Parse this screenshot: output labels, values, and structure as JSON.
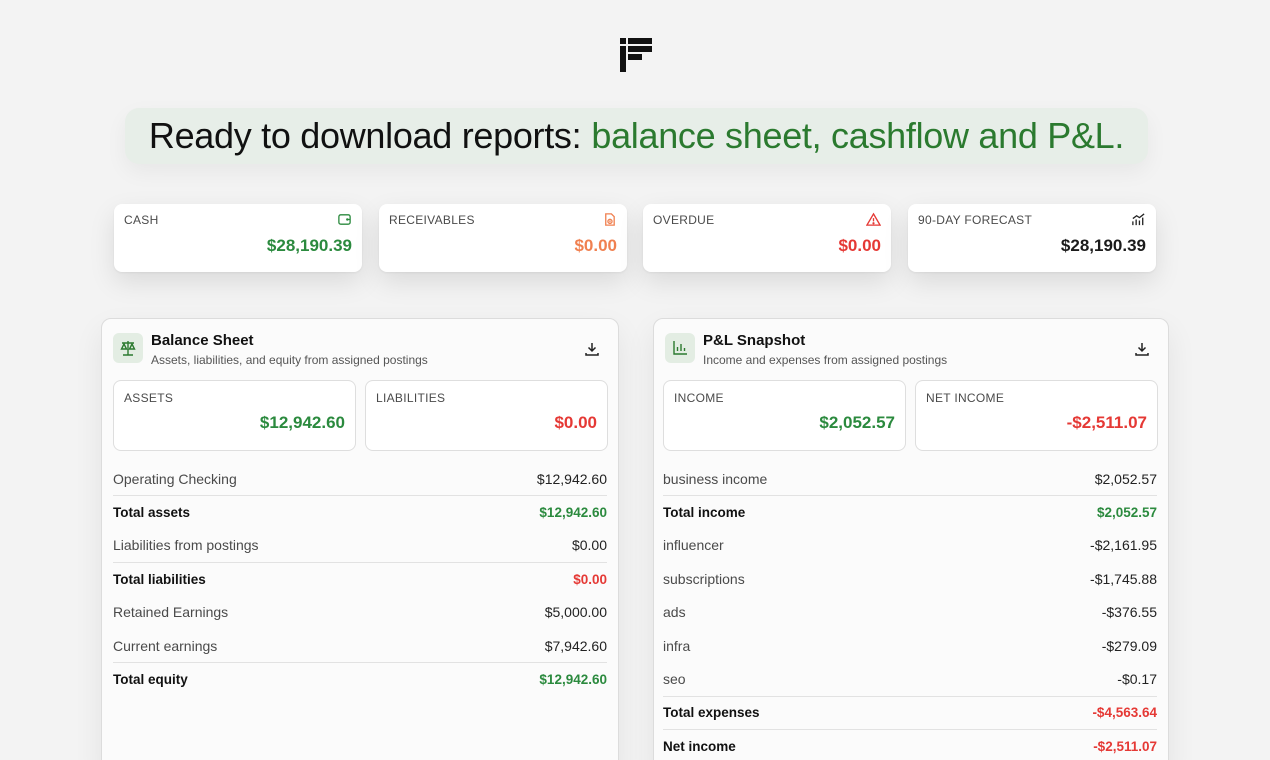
{
  "headline": {
    "dark": "Ready to download reports:",
    "green": "balance sheet, cashflow and P&L."
  },
  "colors": {
    "positive": "#2b8a3e",
    "negative": "#e53935",
    "receivable": "#f08050",
    "brand_green": "#2b7a2f"
  },
  "kpis": [
    {
      "label": "CASH",
      "value": "$28,190.39",
      "icon": "wallet-icon",
      "tone": "pos"
    },
    {
      "label": "RECEIVABLES",
      "value": "$0.00",
      "icon": "receivables-icon",
      "tone": "orange"
    },
    {
      "label": "OVERDUE",
      "value": "$0.00",
      "icon": "alert-triangle-icon",
      "tone": "neg"
    },
    {
      "label": "90-DAY FORECAST",
      "value": "$28,190.39",
      "icon": "trend-chart-icon",
      "tone": "plain"
    }
  ],
  "balance_sheet": {
    "title": "Balance Sheet",
    "subtitle": "Assets, liabilities, and equity from assigned postings",
    "icon": "scale-icon",
    "assets_label": "ASSETS",
    "assets_value": "$12,942.60",
    "liabilities_label": "LIABILITIES",
    "liabilities_value": "$0.00",
    "rows": [
      {
        "label": "Operating Checking",
        "value": "$12,942.60",
        "total": false,
        "tone": ""
      },
      {
        "label": "Total assets",
        "value": "$12,942.60",
        "total": true,
        "tone": "pos"
      },
      {
        "label": "Liabilities from postings",
        "value": "$0.00",
        "total": false,
        "tone": ""
      },
      {
        "label": "Total liabilities",
        "value": "$0.00",
        "total": true,
        "tone": "neg"
      },
      {
        "label": "Retained Earnings",
        "value": "$5,000.00",
        "total": false,
        "tone": ""
      },
      {
        "label": "Current earnings",
        "value": "$7,942.60",
        "total": false,
        "tone": ""
      },
      {
        "label": "Total equity",
        "value": "$12,942.60",
        "total": true,
        "tone": "pos"
      }
    ]
  },
  "pnl": {
    "title": "P&L Snapshot",
    "subtitle": "Income and expenses from assigned postings",
    "icon": "bar-chart-icon",
    "income_label": "INCOME",
    "income_value": "$2,052.57",
    "net_label": "NET INCOME",
    "net_value": "-$2,511.07",
    "rows": [
      {
        "label": "business income",
        "value": "$2,052.57",
        "total": false,
        "tone": ""
      },
      {
        "label": "Total income",
        "value": "$2,052.57",
        "total": true,
        "tone": "pos"
      },
      {
        "label": "influencer",
        "value": "-$2,161.95",
        "total": false,
        "tone": ""
      },
      {
        "label": "subscriptions",
        "value": "-$1,745.88",
        "total": false,
        "tone": ""
      },
      {
        "label": "ads",
        "value": "-$376.55",
        "total": false,
        "tone": ""
      },
      {
        "label": "infra",
        "value": "-$279.09",
        "total": false,
        "tone": ""
      },
      {
        "label": "seo",
        "value": "-$0.17",
        "total": false,
        "tone": ""
      },
      {
        "label": "Total expenses",
        "value": "-$4,563.64",
        "total": true,
        "tone": "neg"
      },
      {
        "label": "Net income",
        "value": "-$2,511.07",
        "total": true,
        "tone": "neg"
      }
    ]
  }
}
